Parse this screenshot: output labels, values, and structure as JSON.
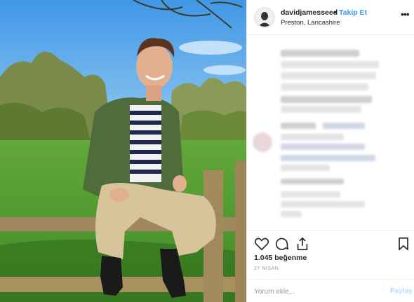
{
  "post": {
    "username": "davidjamesseed",
    "separator": "•",
    "follow_label": "Takip Et",
    "location": "Preston, Lancashire",
    "more_icon": "more-options-icon",
    "more_glyph": "•••"
  },
  "actions": {
    "icons": [
      "heart-icon",
      "comment-icon",
      "share-icon",
      "bookmark-icon"
    ],
    "likes": "1.045 beğenme",
    "date": "27 NİSAN"
  },
  "comment": {
    "placeholder": "Yorum ekle...",
    "post_label": "Paylaş"
  },
  "colors": {
    "accent": "#3897f0",
    "post_disabled": "#b3dbff",
    "text": "#262626",
    "muted": "#999999",
    "sky": "#5aa9ea",
    "grass": "#4f9b2e",
    "jacket": "#4e6b3a"
  }
}
